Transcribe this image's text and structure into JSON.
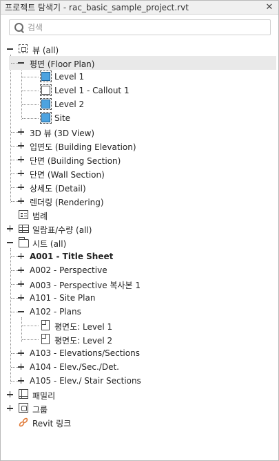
{
  "window": {
    "title": "프로젝트 탐색기 - rac_basic_sample_project.rvt",
    "close_glyph": "✕"
  },
  "search": {
    "placeholder": "검색",
    "value": ""
  },
  "tree": {
    "views_all": "뷰 (all)",
    "floor_plan": "평면 (Floor Plan)",
    "fp_items": [
      "Level 1",
      "Level 1 - Callout 1",
      "Level 2",
      "Site"
    ],
    "view_3d": "3D 뷰 (3D View)",
    "elevation": "입면도 (Building Elevation)",
    "building_section": "단면 (Building Section)",
    "wall_section": "단면 (Wall Section)",
    "detail": "상세도 (Detail)",
    "rendering": "렌더링 (Rendering)",
    "legend": "범례",
    "schedules": "일람표/수량 (all)",
    "sheets_all": "시트 (all)",
    "sheets": {
      "a001": "A001 - Title Sheet",
      "a002": "A002 - Perspective",
      "a003": "A003 - Perspective 복사본 1",
      "a101": "A101 - Site Plan",
      "a102": "A102 - Plans",
      "a102_children": [
        "평면도: Level 1",
        "평면도: Level 2"
      ],
      "a103": "A103 - Elevations/Sections",
      "a104": "A104 - Elev./Sec./Det.",
      "a105": "A105 - Elev./ Stair Sections"
    },
    "families": "패밀리",
    "groups": "그룹",
    "revit_links": "Revit 링크"
  },
  "colors": {
    "accent": "#4da3e0",
    "selection": "#e9e9e9",
    "link": "#e07b39"
  },
  "icons": [
    "view-icon",
    "level-view-icon",
    "callout-view-icon",
    "legend-icon",
    "schedule-icon",
    "sheet-icon",
    "sheet-view-icon",
    "family-icon",
    "group-icon",
    "revit-link-icon",
    "search-icon",
    "close-icon",
    "expand-icon",
    "collapse-icon"
  ]
}
